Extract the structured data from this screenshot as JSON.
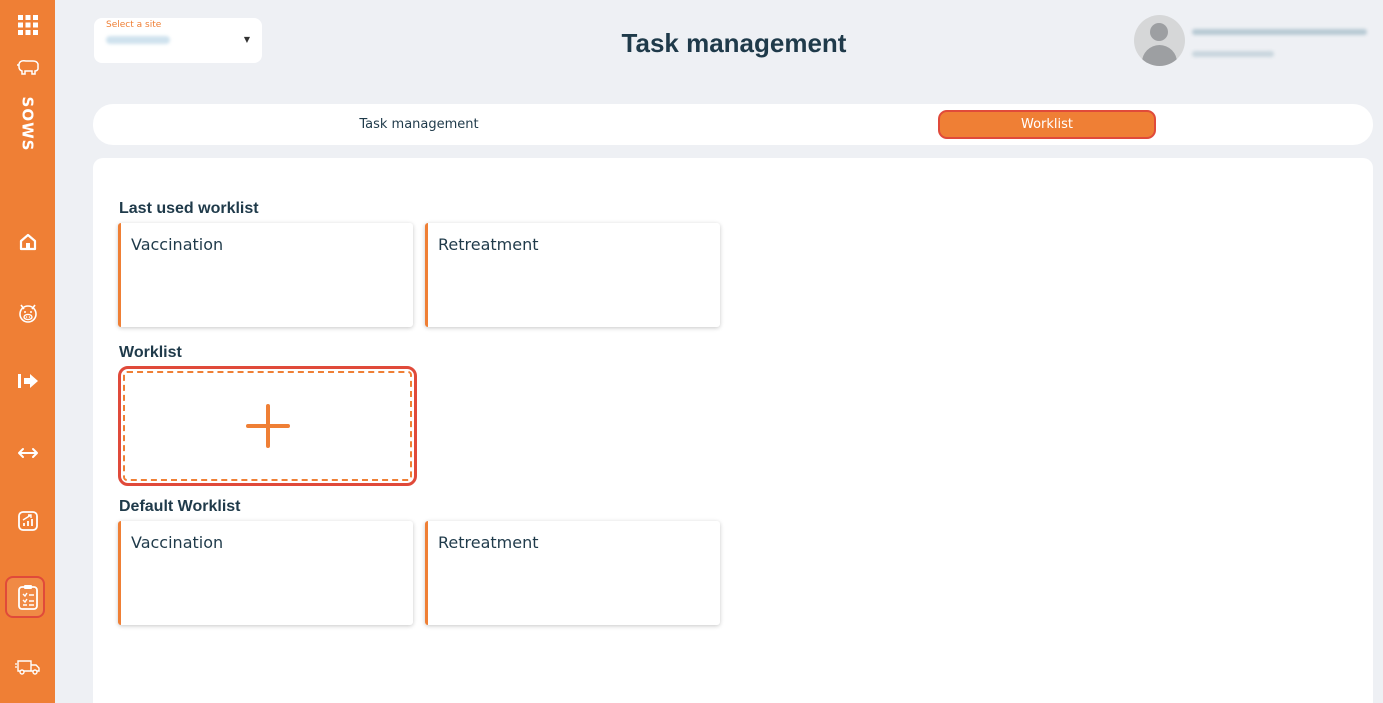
{
  "app": {
    "brand": "SOWS",
    "accent_color": "#ef7f35"
  },
  "sidebar": {
    "items": [
      {
        "icon": "apps-grid-icon"
      },
      {
        "icon": "pig-outline-icon"
      },
      {
        "icon": "home-icon"
      },
      {
        "icon": "pig-face-icon"
      },
      {
        "icon": "move-in-icon"
      },
      {
        "icon": "transfer-icon"
      },
      {
        "icon": "analytics-icon"
      },
      {
        "icon": "clipboard-icon",
        "active": true
      },
      {
        "icon": "truck-icon"
      }
    ]
  },
  "header": {
    "site_label": "Select a site",
    "title": "Task management"
  },
  "tabs": [
    {
      "label": "Task management",
      "active": false
    },
    {
      "label": "Worklist",
      "active": true
    }
  ],
  "sections": {
    "last_used": {
      "title": "Last used worklist",
      "cards": [
        {
          "label": "Vaccination"
        },
        {
          "label": "Retreatment"
        }
      ]
    },
    "worklist": {
      "title": "Worklist"
    },
    "default": {
      "title": "Default Worklist",
      "cards": [
        {
          "label": "Vaccination"
        },
        {
          "label": "Retreatment"
        }
      ]
    }
  }
}
